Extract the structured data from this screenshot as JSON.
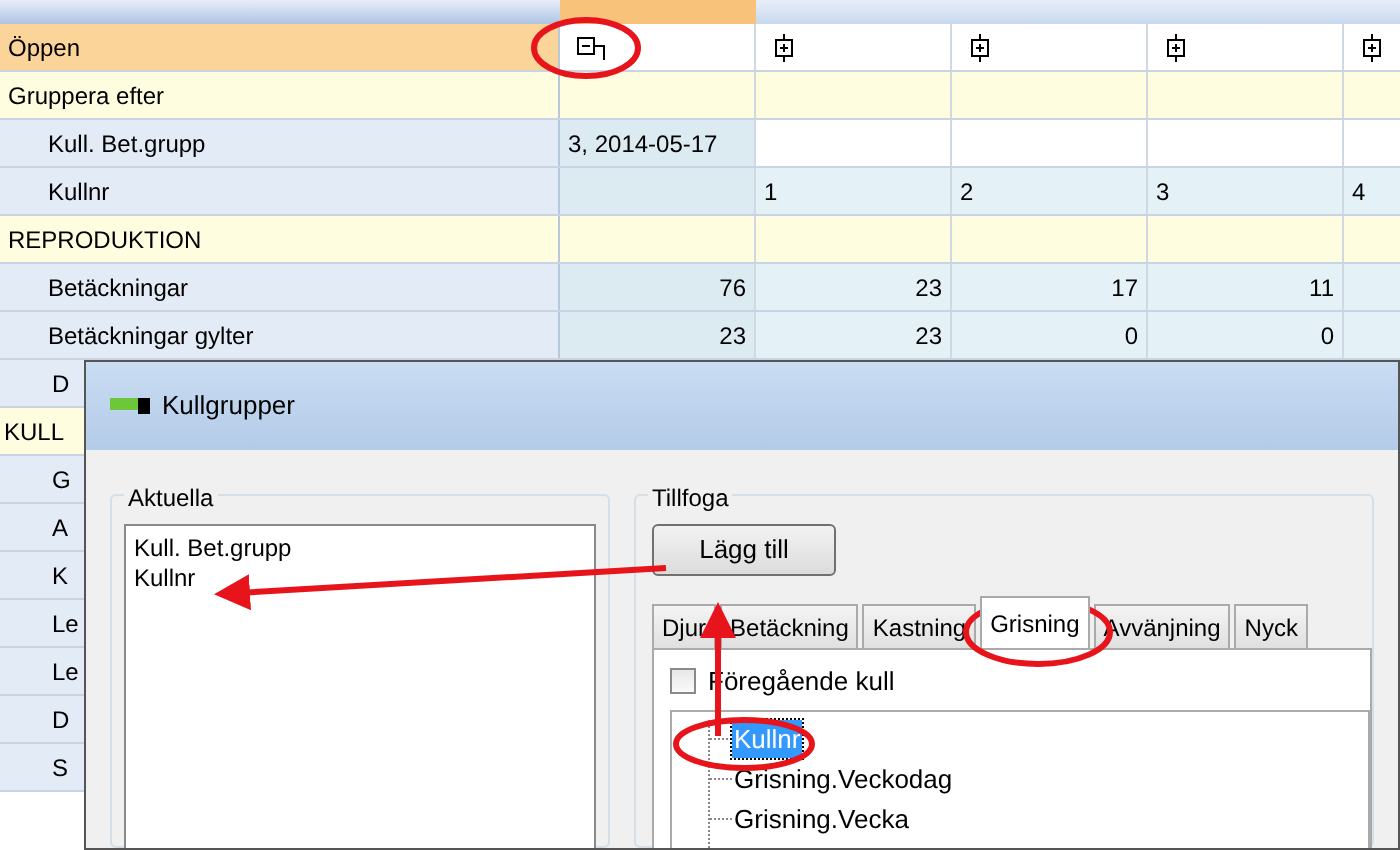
{
  "grid": {
    "header_label": "Öppen",
    "columns": [
      {
        "expanded": true
      },
      {
        "expanded": false
      },
      {
        "expanded": false
      },
      {
        "expanded": false
      },
      {
        "expanded": false
      }
    ],
    "rows": [
      {
        "kind": "section",
        "label": "Gruppera efter",
        "cells": [
          "",
          "",
          "",
          "",
          ""
        ]
      },
      {
        "kind": "group",
        "label": "Kull. Bet.grupp",
        "cells": [
          "3, 2014-05-17",
          "",
          "",
          "",
          ""
        ]
      },
      {
        "kind": "group",
        "label": "Kullnr",
        "cells": [
          "",
          "1",
          "2",
          "3",
          "4"
        ]
      },
      {
        "kind": "section",
        "label": "REPRODUKTION",
        "cells": [
          "",
          "",
          "",
          "",
          ""
        ]
      },
      {
        "kind": "measure",
        "label": "Betäckningar",
        "cells": [
          "76",
          "23",
          "17",
          "11",
          ""
        ]
      },
      {
        "kind": "measure",
        "label": "Betäckningar gylter",
        "cells": [
          "23",
          "23",
          "0",
          "0",
          ""
        ]
      }
    ],
    "hidden_rows": [
      {
        "kind": "measure",
        "label": "D"
      },
      {
        "kind": "section",
        "label": "KULL"
      },
      {
        "kind": "measure",
        "label": "G"
      },
      {
        "kind": "measure",
        "label": "A"
      },
      {
        "kind": "measure",
        "label": "K"
      },
      {
        "kind": "measure",
        "label": "Le"
      },
      {
        "kind": "measure",
        "label": "Le"
      },
      {
        "kind": "measure",
        "label": "D"
      },
      {
        "kind": "measure",
        "label": "S"
      }
    ]
  },
  "dialog": {
    "title": "Kullgrupper",
    "current": {
      "title": "Aktuella",
      "items": [
        "Kull. Bet.grupp",
        "Kullnr"
      ]
    },
    "add": {
      "title": "Tillfoga",
      "button": "Lägg till",
      "tabs": [
        {
          "label": "Djur",
          "selected": false
        },
        {
          "label": "Betäckning",
          "selected": false
        },
        {
          "label": "Kastning",
          "selected": false
        },
        {
          "label": "Grisning",
          "selected": true
        },
        {
          "label": "Avvänjning",
          "selected": false
        },
        {
          "label": "Nyck",
          "selected": false
        }
      ],
      "checkbox": {
        "label": "Föregående kull",
        "checked": false
      },
      "tree": [
        {
          "label": "Kullnr",
          "selected": true
        },
        {
          "label": "Grisning.Veckodag",
          "selected": false
        },
        {
          "label": "Grisning.Vecka",
          "selected": false
        }
      ]
    }
  }
}
